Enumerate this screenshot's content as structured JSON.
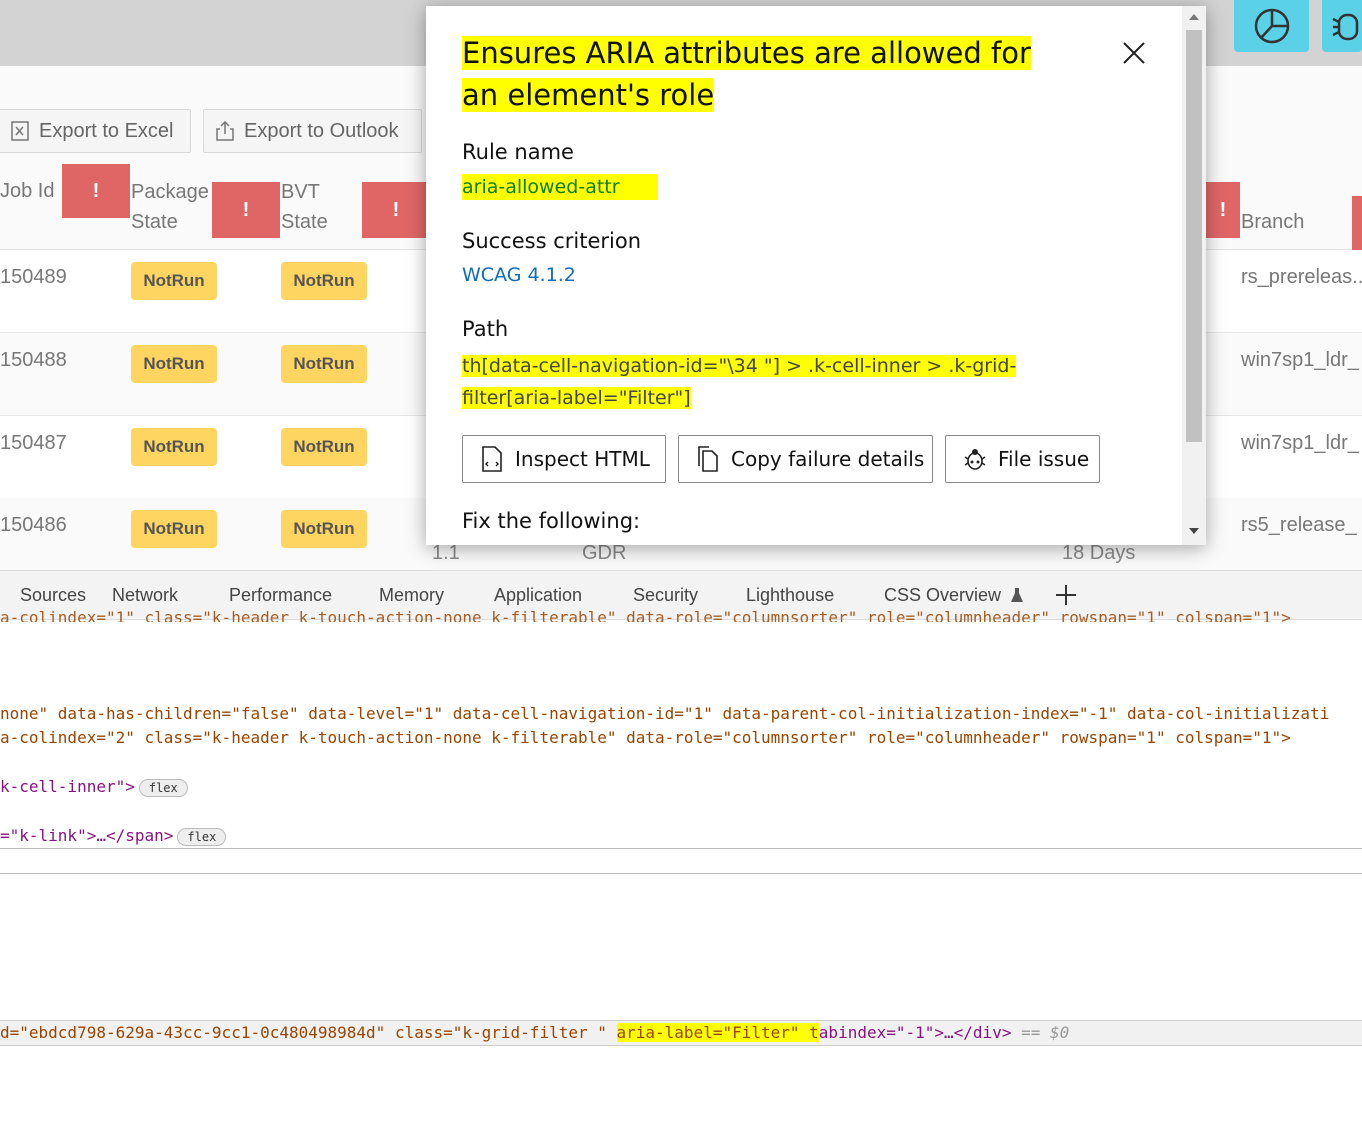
{
  "toolbar": {
    "export_excel": "Export to Excel",
    "export_outlook": "Export to Outlook"
  },
  "grid": {
    "headers": {
      "job_id": "Job Id",
      "package_state_1": "Package",
      "package_state_2": "State",
      "bvt_state_1": "BVT",
      "bvt_state_2": "State",
      "branch": "Branch"
    },
    "warning_glyph": "!",
    "rows": [
      {
        "job_id": "150489",
        "package_state": "NotRun",
        "bvt_state": "NotRun",
        "branch": "rs_prereleas..."
      },
      {
        "job_id": "150488",
        "package_state": "NotRun",
        "bvt_state": "NotRun",
        "branch": "win7sp1_ldr_"
      },
      {
        "job_id": "150487",
        "package_state": "NotRun",
        "bvt_state": "NotRun",
        "branch": "win7sp1_ldr_"
      },
      {
        "job_id": "150486",
        "package_state": "NotRun",
        "bvt_state": "NotRun",
        "branch": "rs5_release_"
      }
    ],
    "partial_row": {
      "a": "1.1",
      "b": "GDR",
      "c": "18 Days"
    }
  },
  "devtools": {
    "tabs": [
      "Sources",
      "Network",
      "Performance",
      "Memory",
      "Application",
      "Security",
      "Lighthouse",
      "CSS Overview"
    ],
    "code": {
      "line0": "a-colindex=\"1\" class=\"k-header k-touch-action-none     k-filterable\" data-role=\"columnsorter\" role=\"columnheader\" rowspan=\"1\" colspan=\"1\">",
      "line1": "none\" data-has-children=\"false\" data-level=\"1\" data-cell-navigation-id=\"1\" data-parent-col-initialization-index=\"-1\" data-col-initializati",
      "line2": "a-colindex=\"2\" class=\"k-header k-touch-action-none     k-filterable\" data-role=\"columnsorter\" role=\"columnheader\" rowspan=\"1\" colspan=\"1\">",
      "line3": "k-cell-inner\">",
      "line3_pill": "flex",
      "line4": "=\"k-link\">…</span>",
      "line4_pill": "flex",
      "line5_a": "d=\"ebdcd798-629a-43cc-9cc1-0c480498984d\" class=\"k-grid-filter  \" ",
      "line5_b": "aria-label=\"Filter\" t",
      "line5_c": "abindex=\"-1\">…</div>",
      "line5_d": " == $0"
    }
  },
  "dialog": {
    "title": "Ensures ARIA attributes are allowed for an element's role",
    "rule_name_label": "Rule name",
    "rule_name": "aria-allowed-attr",
    "success_label": "Success criterion",
    "success_value": "WCAG 4.1.2",
    "path_label": "Path",
    "path_value": "th[data-cell-navigation-id=\"\\34 \"] > .k-cell-inner > .k-grid-filter[aria-label=\"Filter\"]",
    "buttons": {
      "inspect": "Inspect HTML",
      "copy": "Copy failure details",
      "file": "File issue"
    },
    "fix_label": "Fix the following:",
    "colors": {
      "link": "#0f6cbd",
      "rule": "#107c10",
      "highlight": "#ffff00"
    }
  }
}
